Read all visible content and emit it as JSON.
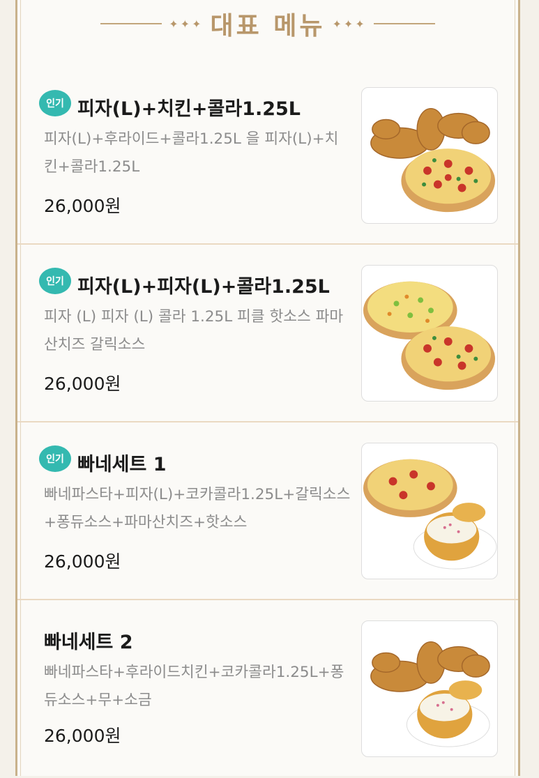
{
  "header": {
    "title": "대표 메뉴",
    "stars_left": "✦✦✦",
    "stars_right": "✦✦✦"
  },
  "items": [
    {
      "badge": "인기",
      "title": "피자(L)+치킨+콜라1.25L",
      "description": "피자(L)+후라이드+콜라1.25L 을 피자(L)+치킨+콜라1.25L",
      "price": "26,000원",
      "image": "chicken-pizza-image"
    },
    {
      "badge": "인기",
      "title": "피자(L)+피자(L)+콜라1.25L",
      "description": "피자 (L) 피자 (L) 콜라 1.25L 피클 핫소스 파마산치즈 갈릭소스",
      "price": "26,000원",
      "image": "two-pizzas-image"
    },
    {
      "badge": "인기",
      "title": "빠네세트 1",
      "description": "빠네파스타+피자(L)+코카콜라1.25L+갈릭소스+퐁듀소스+파마산치즈+핫소스",
      "price": "26,000원",
      "image": "pizza-pane-pasta-image"
    },
    {
      "badge": "",
      "title": "빠네세트 2",
      "description": "빠네파스타+후라이드치킨+코카콜라1.25L+퐁듀소스+무+소금",
      "price": "26,000원",
      "image": "chicken-pane-pasta-image"
    }
  ],
  "colors": {
    "badge": "#34b9b0",
    "accent": "#b8976b",
    "frame": "#c9b28c"
  }
}
